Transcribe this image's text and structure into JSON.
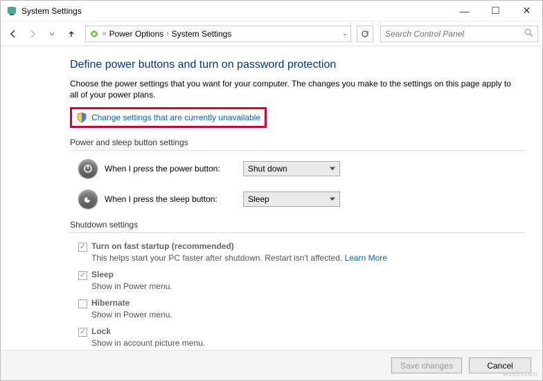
{
  "window": {
    "title": "System Settings"
  },
  "breadcrumb": {
    "item1": "Power Options",
    "item2": "System Settings"
  },
  "search": {
    "placeholder": "Search Control Panel"
  },
  "page": {
    "heading": "Define power buttons and turn on password protection",
    "desc": "Choose the power settings that you want for your computer. The changes you make to the settings on this page apply to all of your power plans.",
    "change_link": "Change settings that are currently unavailable"
  },
  "sections": {
    "button_settings_header": "Power and sleep button settings",
    "shutdown_settings_header": "Shutdown settings"
  },
  "rows": {
    "power": {
      "label": "When I press the power button:",
      "value": "Shut down"
    },
    "sleep": {
      "label": "When I press the sleep button:",
      "value": "Sleep"
    }
  },
  "checks": {
    "fast_startup": {
      "label": "Turn on fast startup (recommended)",
      "sub": "This helps start your PC faster after shutdown. Restart isn't affected. ",
      "learn": "Learn More"
    },
    "sleep": {
      "label": "Sleep",
      "sub": "Show in Power menu."
    },
    "hibernate": {
      "label": "Hibernate",
      "sub": "Show in Power menu."
    },
    "lock": {
      "label": "Lock",
      "sub": "Show in account picture menu."
    }
  },
  "footer": {
    "save": "Save changes",
    "cancel": "Cancel"
  },
  "watermark": "wsxdn.com"
}
